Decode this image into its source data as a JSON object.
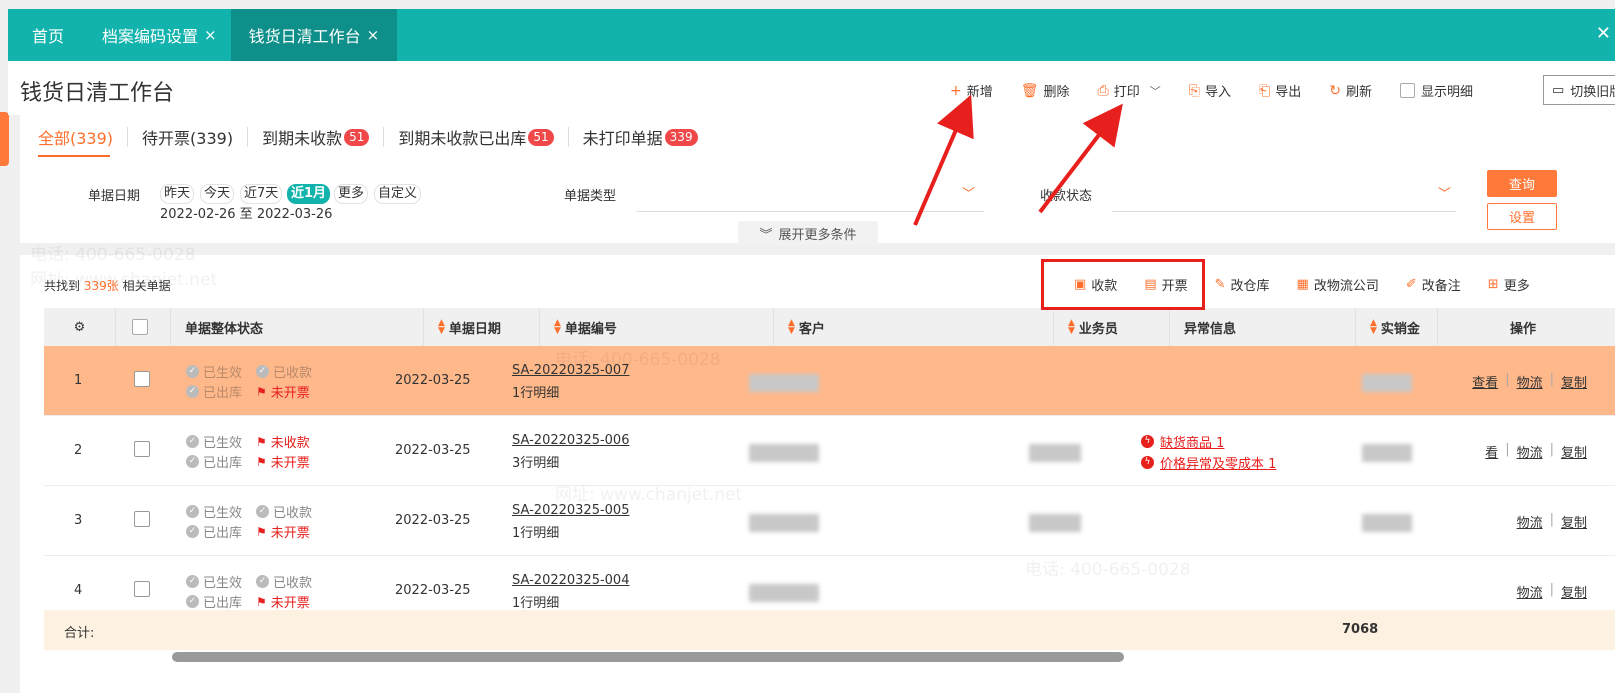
{
  "tabs": [
    {
      "label": "首页",
      "closable": false
    },
    {
      "label": "档案编码设置",
      "closable": true
    },
    {
      "label": "钱货日清工作台",
      "closable": true,
      "active": true
    }
  ],
  "page": {
    "title": "钱货日清工作台"
  },
  "toolbar": {
    "add": "新增",
    "delete": "删除",
    "print": "打印",
    "import": "导入",
    "export": "导出",
    "refresh": "刷新",
    "show_detail": "显示明细",
    "switch_old": "切换旧版"
  },
  "status_tabs": [
    {
      "label": "全部(339)",
      "badge": null
    },
    {
      "label": "待开票(339)",
      "badge": null
    },
    {
      "label": "到期未收款",
      "badge": "51"
    },
    {
      "label": "到期未收款已出库",
      "badge": "51"
    },
    {
      "label": "未打印单据",
      "badge": "339"
    }
  ],
  "filters": {
    "date_label": "单据日期",
    "date_chips": [
      "昨天",
      "今天",
      "近7天",
      "近1月",
      "更多",
      "自定义"
    ],
    "date_range": "2022-02-26 至 2022-03-26",
    "type_label": "单据类型",
    "payment_label": "收款状态",
    "query": "查询",
    "settings": "设置",
    "expand": "展开更多条件"
  },
  "list": {
    "found_prefix": "共找到",
    "found_count": "339张",
    "found_suffix": "相关单据",
    "actions": [
      "收款",
      "开票",
      "改仓库",
      "改物流公司",
      "改备注",
      "更多"
    ]
  },
  "columns": [
    "单据整体状态",
    "单据日期",
    "单据编号",
    "客户",
    "业务员",
    "异常信息",
    "实销金",
    "操作"
  ],
  "rows": [
    {
      "num": "1",
      "status": {
        "effective": "已生效",
        "pay": "已收款",
        "out": "已出库",
        "invoice": "未开票"
      },
      "pay_red": false,
      "date": "2022-03-25",
      "bill_no": "SA-20220325-007",
      "lines": "1行明细",
      "warnings": [],
      "ops": [
        "查看",
        "物流",
        "复制"
      ]
    },
    {
      "num": "2",
      "status": {
        "effective": "已生效",
        "pay": "未收款",
        "out": "已出库",
        "invoice": "未开票"
      },
      "pay_red": true,
      "date": "2022-03-25",
      "bill_no": "SA-20220325-006",
      "lines": "3行明细",
      "warnings": [
        "缺货商品 1",
        "价格异常及零成本 1"
      ],
      "ops": [
        "看",
        "物流",
        "复制"
      ]
    },
    {
      "num": "3",
      "status": {
        "effective": "已生效",
        "pay": "已收款",
        "out": "已出库",
        "invoice": "未开票"
      },
      "pay_red": false,
      "date": "2022-03-25",
      "bill_no": "SA-20220325-005",
      "lines": "1行明细",
      "warnings": [],
      "ops": [
        "物流",
        "复制"
      ]
    },
    {
      "num": "4",
      "status": {
        "effective": "已生效",
        "pay": "已收款",
        "out": "已出库",
        "invoice": "未开票"
      },
      "pay_red": false,
      "date": "2022-03-25",
      "bill_no": "SA-20220325-004",
      "lines": "1行明细",
      "warnings": [],
      "ops": [
        "物流",
        "复制"
      ]
    }
  ],
  "totals": {
    "label": "合计:",
    "amount": "7068"
  },
  "watermark": {
    "phone": "电话: 400-665-0028",
    "site": "网址: www.chanjet.net"
  },
  "colors": {
    "teal": "#13b3ad",
    "orange": "#ff7a3a",
    "red": "#e8201d",
    "highlight_row": "#ffb88a"
  }
}
